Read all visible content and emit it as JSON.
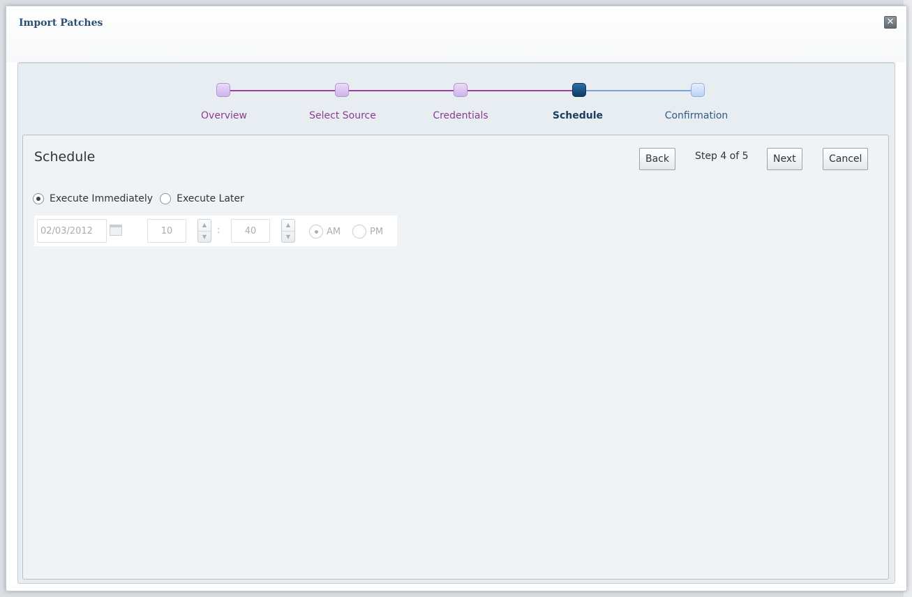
{
  "dialog": {
    "title": "Import Patches",
    "close_label": "✕"
  },
  "train": {
    "steps": [
      {
        "label": "Overview",
        "state": "visited"
      },
      {
        "label": "Select Source",
        "state": "visited"
      },
      {
        "label": "Credentials",
        "state": "visited"
      },
      {
        "label": "Schedule",
        "state": "current"
      },
      {
        "label": "Confirmation",
        "state": "future"
      }
    ]
  },
  "panel": {
    "title": "Schedule",
    "back_label": "Back",
    "step_text": "Step 4 of 5",
    "next_label": "Next",
    "cancel_label": "Cancel"
  },
  "execution": {
    "immediately_label": "Execute Immediately",
    "later_label": "Execute Later",
    "selected": "immediately"
  },
  "schedule": {
    "date_value": "02/03/2012",
    "hour_value": "10",
    "minute_value": "40",
    "separator": ":",
    "am_label": "AM",
    "pm_label": "PM",
    "selected_meridiem": "AM",
    "spin_up": "▲",
    "spin_down": "▼"
  },
  "colors": {
    "title": "#2b4e72",
    "visited_label": "#8a3c92",
    "current_stop": "#1b3e63",
    "future_stop": "#2f5a86"
  }
}
